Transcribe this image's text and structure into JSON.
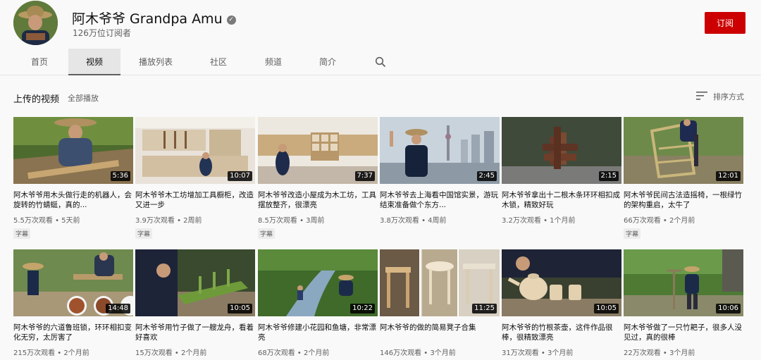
{
  "channel": {
    "name": "阿木爷爷 Grandpa Amu",
    "subscribers": "126万位订阅者",
    "subscribe_label": "订阅",
    "verified_glyph": "✓"
  },
  "tabs": [
    {
      "label": "首页"
    },
    {
      "label": "视频",
      "active": true
    },
    {
      "label": "播放列表"
    },
    {
      "label": "社区"
    },
    {
      "label": "频道"
    },
    {
      "label": "简介"
    }
  ],
  "section": {
    "title": "上传的视频",
    "play_all": "全部播放",
    "sort_label": "排序方式"
  },
  "videos": [
    {
      "title": "阿木爷爷用木头做行走的机器人，会旋转的竹蜻蜓，真的...",
      "meta": "5.5万次观看 • 5天前",
      "duration": "5:36",
      "badge": "字幕"
    },
    {
      "title": "阿木爷爷木工坊增加工具橱柜，改造又进一步",
      "meta": "3.9万次观看 • 2周前",
      "duration": "10:07",
      "badge": "字幕"
    },
    {
      "title": "阿木爷爷改造小屋成为木工坊，工具摆放整齐，很漂亮",
      "meta": "8.5万次观看 • 3周前",
      "duration": "7:37",
      "badge": "字幕"
    },
    {
      "title": "阿木爷爷去上海看中国馆实景，游玩结束准备做个东方...",
      "meta": "3.8万次观看 • 4周前",
      "duration": "2:45"
    },
    {
      "title": "阿木爷爷拿出十二根木条环环相扣成木锁，精致好玩",
      "meta": "3.2万次观看 • 1个月前",
      "duration": "2:15"
    },
    {
      "title": "阿木爷爷民间古法造摇椅，一根绿竹的架构重启，太牛了",
      "meta": "66万次观看 • 2个月前",
      "duration": "12:01",
      "badge": "字幕"
    },
    {
      "title": "阿木爷爷的六道鲁班锁，环环相扣变化无穷，太厉害了",
      "meta": "215万次观看 • 2个月前",
      "duration": "14:48"
    },
    {
      "title": "阿木爷爷用竹子做了一艘龙舟，看着好喜欢",
      "meta": "15万次观看 • 2个月前",
      "duration": "10:05"
    },
    {
      "title": "阿木爷爷修建小花园和鱼塘，非常漂亮",
      "meta": "68万次观看 • 2个月前",
      "duration": "10:22"
    },
    {
      "title": "阿木爷爷的做的简易凳子合集",
      "meta": "146万次观看 • 3个月前",
      "duration": "11:25"
    },
    {
      "title": "阿木爷爷的竹根茶壶，这件作品很棒，很精致漂亮",
      "meta": "31万次观看 • 3个月前",
      "duration": "10:05"
    },
    {
      "title": "阿木爷爷做了一只竹耙子，很多人没见过，真的很棒",
      "meta": "22万次观看 • 3个月前",
      "duration": "10:06"
    }
  ],
  "colors": {
    "accent": "#cc0000",
    "background": "#f9f9f9",
    "text_secondary": "#606060"
  }
}
